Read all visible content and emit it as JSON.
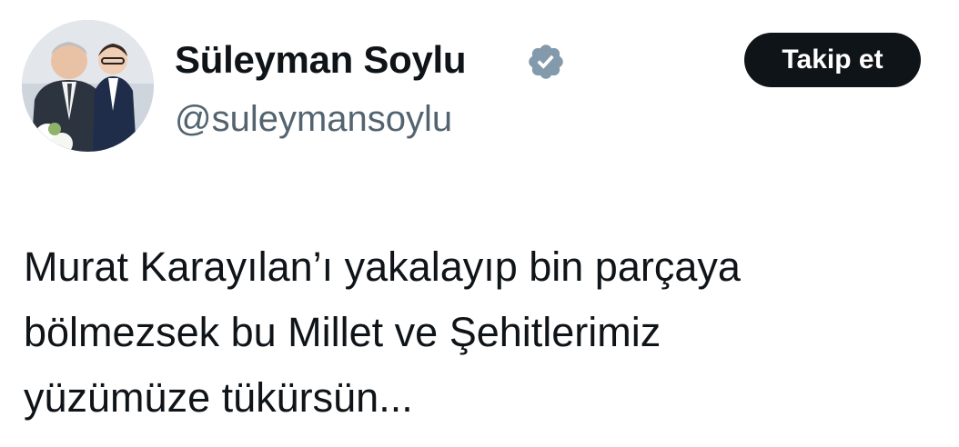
{
  "author": {
    "display_name": "Süleyman Soylu",
    "handle": "@suleymansoylu",
    "verified": true,
    "avatar": "profile-photo"
  },
  "follow_button": {
    "label": "Takip et"
  },
  "tweet": {
    "lines": [
      "Murat Karayılan’ı yakalayıp bin parçaya",
      "bölmezsek bu Millet ve Şehitlerimiz",
      "yüzümüze tükürsün..."
    ]
  },
  "colors": {
    "text": "#0f1419",
    "secondary": "#536471",
    "button_bg": "#0f1419",
    "verified_badge": "#829aab"
  }
}
